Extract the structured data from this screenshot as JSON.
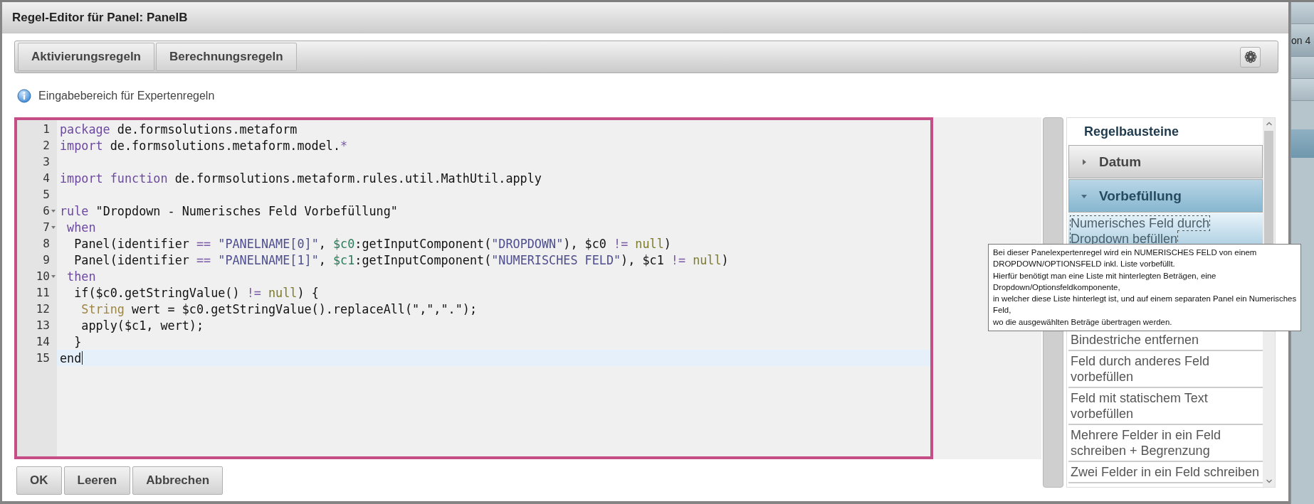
{
  "window": {
    "title": "Regel-Editor für Panel: PanelB"
  },
  "toolbar": {
    "buttons": [
      {
        "label": "Aktivierungsregeln"
      },
      {
        "label": "Berechnungsregeln"
      }
    ]
  },
  "info": {
    "text": "Eingabebereich für Expertenregeln"
  },
  "editor": {
    "lines": [
      {
        "number": "1",
        "tokens": [
          {
            "kind": "keyword",
            "text": "package"
          },
          {
            "kind": "plain",
            "text": " de.formsolutions.metaform"
          }
        ]
      },
      {
        "number": "2",
        "tokens": [
          {
            "kind": "keyword",
            "text": "import"
          },
          {
            "kind": "plain",
            "text": " de.formsolutions.metaform.model."
          },
          {
            "kind": "operator",
            "text": "*"
          }
        ]
      },
      {
        "number": "3"
      },
      {
        "number": "4",
        "tokens": [
          {
            "kind": "keyword",
            "text": "import"
          },
          {
            "kind": "keyword",
            "text": " function"
          },
          {
            "kind": "plain",
            "text": " de.formsolutions.metaform.rules.util.MathUtil.apply"
          }
        ]
      },
      {
        "number": "5"
      },
      {
        "number": "6",
        "foldable": true,
        "tokens": [
          {
            "kind": "keyword",
            "text": "rule"
          },
          {
            "kind": "plain",
            "text": " \"Dropdown - Numerisches Feld Vorbefüllung\""
          }
        ]
      },
      {
        "number": "7",
        "foldable": true,
        "tokens": [
          {
            "kind": "keyword",
            "text": " when"
          }
        ]
      },
      {
        "number": "8",
        "tokens": [
          {
            "kind": "plain",
            "text": "  Panel(identifier "
          },
          {
            "kind": "operator",
            "text": "=="
          },
          {
            "kind": "string",
            "text": " \"PANELNAME[0]\""
          },
          {
            "kind": "plain",
            "text": ", "
          },
          {
            "kind": "variable",
            "text": "$c0"
          },
          {
            "kind": "plain",
            "text": ":getInputComponent("
          },
          {
            "kind": "string",
            "text": "\"DROPDOWN\""
          },
          {
            "kind": "plain",
            "text": "), $c0 "
          },
          {
            "kind": "operator",
            "text": "!="
          },
          {
            "kind": "literal",
            "text": " null"
          },
          {
            "kind": "plain",
            "text": ")"
          }
        ]
      },
      {
        "number": "9",
        "tokens": [
          {
            "kind": "plain",
            "text": "  Panel(identifier "
          },
          {
            "kind": "operator",
            "text": "=="
          },
          {
            "kind": "string",
            "text": " \"PANELNAME[1]\""
          },
          {
            "kind": "plain",
            "text": ", "
          },
          {
            "kind": "variable",
            "text": "$c1"
          },
          {
            "kind": "plain",
            "text": ":getInputComponent("
          },
          {
            "kind": "string",
            "text": "\"NUMERISCHES FELD\""
          },
          {
            "kind": "plain",
            "text": "), $c1 "
          },
          {
            "kind": "operator",
            "text": "!="
          },
          {
            "kind": "literal",
            "text": " null"
          },
          {
            "kind": "plain",
            "text": ")"
          }
        ]
      },
      {
        "number": "10",
        "foldable": true,
        "tokens": [
          {
            "kind": "keyword",
            "text": " then"
          }
        ]
      },
      {
        "number": "11",
        "tokens": [
          {
            "kind": "plain",
            "text": "  if($c0.getStringValue() "
          },
          {
            "kind": "operator",
            "text": "!="
          },
          {
            "kind": "literal",
            "text": " null"
          },
          {
            "kind": "plain",
            "text": ") {"
          }
        ]
      },
      {
        "number": "12",
        "tokens": [
          {
            "kind": "type",
            "text": "   String"
          },
          {
            "kind": "plain",
            "text": " wert = $c0.getStringValue().replaceAll(\",\",\".\");"
          }
        ]
      },
      {
        "number": "13",
        "tokens": [
          {
            "kind": "plain",
            "text": "   apply($c1, wert);"
          }
        ]
      },
      {
        "number": "14",
        "tokens": [
          {
            "kind": "plain",
            "text": "  }"
          }
        ]
      },
      {
        "number": "15",
        "active": true,
        "cursor": true,
        "tokens": [
          {
            "kind": "plain",
            "text": "end"
          }
        ]
      }
    ]
  },
  "buttons": [
    {
      "label": "OK"
    },
    {
      "label": "Leeren"
    },
    {
      "label": "Abbrechen"
    }
  ],
  "sidebar": {
    "title": "Regelbausteine",
    "sections": [
      {
        "label": "Datum",
        "expanded": false
      },
      {
        "label": "Vorbefüllung",
        "expanded": true,
        "items": [
          {
            "label": "Numerisches Feld durch Dropdown befüllen",
            "selected": true
          },
          {
            "label": "Bindestriche entfernen",
            "selected": false
          },
          {
            "label": "Feld durch anderes Feld vorbefüllen",
            "selected": false
          },
          {
            "label": "Feld mit statischem Text vorbefüllen",
            "selected": false
          },
          {
            "label": "Mehrere Felder in ein Feld schreiben + Begrenzung",
            "selected": false
          },
          {
            "label": "Zwei Felder in ein Feld schreiben",
            "selected": false
          }
        ]
      }
    ]
  },
  "tooltip": {
    "text": "Bei dieser Panelexpertenregel wird ein NUMERISCHES FELD von einem\nDROPDOWN/OPTIONSFELD inkl. Liste vorbefüllt.\nHierfür benötigt man eine Liste mit hinterlegten Beträgen, eine\nDropdown/Optionsfeldkomponente,\nin welcher diese Liste hinterlegt ist, und auf einem separaten Panel ein Numerisches\nFeld,\nwo die ausgewählten Beträge übertragen werden."
  },
  "background_page": {
    "text": "on 4"
  }
}
